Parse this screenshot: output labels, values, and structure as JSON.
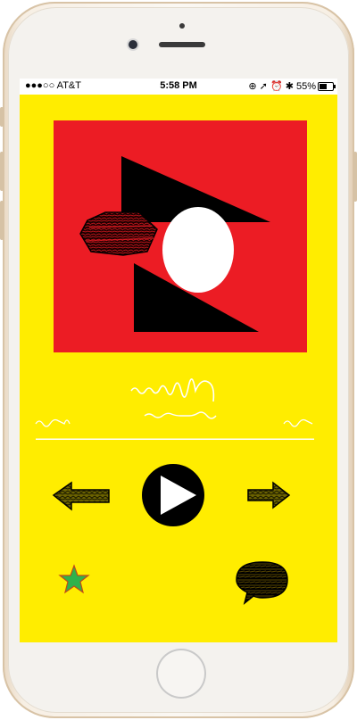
{
  "status_bar": {
    "carrier": "●●●○○ AT&T",
    "time": "5:58 PM",
    "right_indicators": "⊕ ➚ ⏰ ✱ 55%",
    "battery_level": 0.55
  },
  "now_playing": {
    "title": "",
    "artist": "",
    "progress": 1.0
  },
  "controls": {
    "previous": "previous-arrow-icon",
    "play": "play-icon",
    "next": "next-arrow-icon"
  },
  "actions": {
    "favorite": "star-icon",
    "comment": "speech-bubble-icon"
  },
  "colors": {
    "screen_bg": "#ffed00",
    "art_bg": "#ec1c24",
    "star": "#2fb24c",
    "track_line": "#ffffff"
  }
}
